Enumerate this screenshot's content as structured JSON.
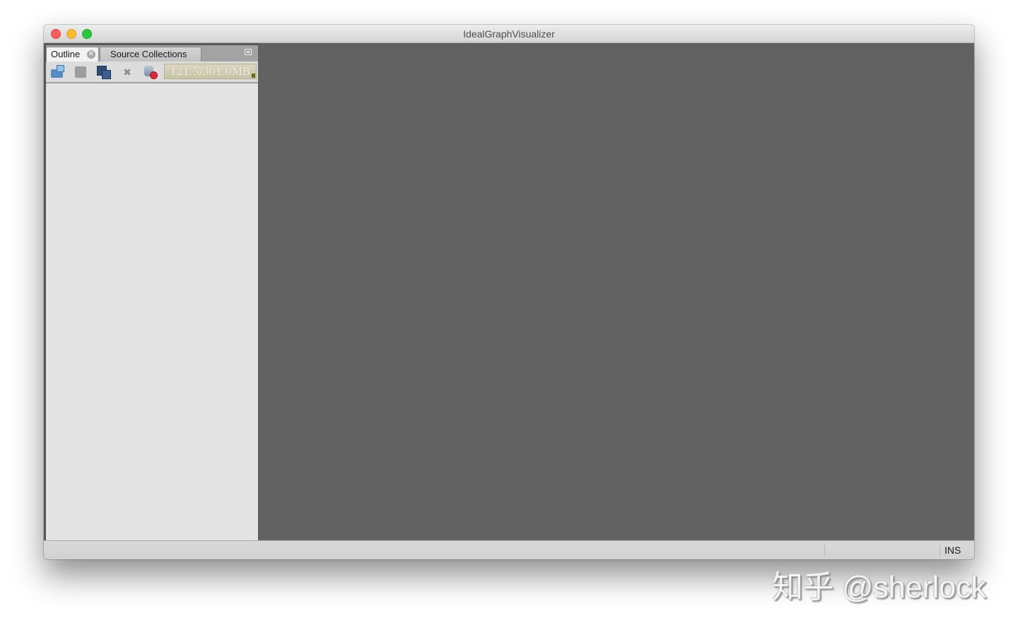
{
  "window": {
    "title": "IdealGraphVisualizer"
  },
  "left_panel": {
    "tabs": [
      {
        "label": "Outline",
        "active": true,
        "closable": true
      },
      {
        "label": "Source Collections",
        "active": false
      }
    ],
    "toolbar": {
      "buttons": [
        {
          "name": "open",
          "icon": "folder-open-icon"
        },
        {
          "name": "save",
          "icon": "floppy-disk-icon",
          "enabled": false
        },
        {
          "name": "save-all",
          "icon": "save-all-icon"
        },
        {
          "name": "remove",
          "icon": "x-icon"
        },
        {
          "name": "remove-all",
          "icon": "database-remove-icon"
        }
      ],
      "memory": "121.5/301.0MB"
    }
  },
  "status_bar": {
    "insert_mode": "INS"
  },
  "watermark": "知乎 @sherlock"
}
